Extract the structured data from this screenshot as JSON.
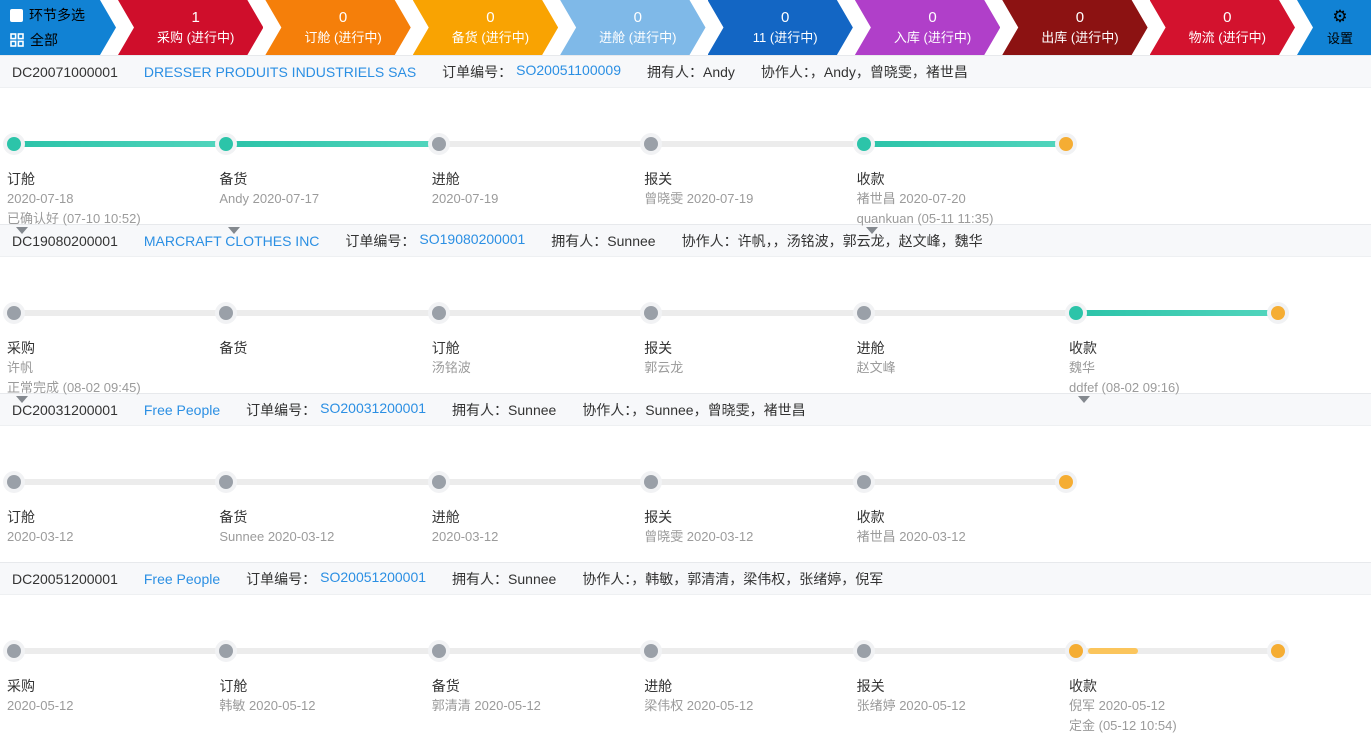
{
  "header": {
    "filter": {
      "multi_label": "环节多选",
      "all_label": "全部"
    },
    "stages": [
      {
        "count": "1",
        "label": "采购 (进行中)",
        "color": "#cf0e2b"
      },
      {
        "count": "0",
        "label": "订舱 (进行中)",
        "color": "#f57f0a"
      },
      {
        "count": "0",
        "label": "备货 (进行中)",
        "color": "#f9a302"
      },
      {
        "count": "0",
        "label": "进舱 (进行中)",
        "color": "#7fb9e8"
      },
      {
        "count": "0",
        "label": "11 (进行中)",
        "color": "#1366c4"
      },
      {
        "count": "0",
        "label": "入库 (进行中)",
        "color": "#b03fc9"
      },
      {
        "count": "0",
        "label": "出库 (进行中)",
        "color": "#8c1212"
      },
      {
        "count": "0",
        "label": "物流 (进行中)",
        "color": "#d3122e"
      }
    ],
    "filter_color": "#1182d4",
    "settings_label": "设置",
    "settings_color": "#1182d4",
    "gear_icon": "⚙"
  },
  "labels": {
    "order_no": "订单编号：",
    "owner": "拥有人：",
    "collaborators": "协作人："
  },
  "colors": {
    "done_teal": "#2cc4a9",
    "pending_gray": "#9aa0a8",
    "end_orange": "#f5ad33",
    "partial_orange": "#fbc55c",
    "link_blue": "#2b8fe3"
  },
  "orders": [
    {
      "code": "DC20071000001",
      "company": "DRESSER PRODUITS INDUSTRIELS SAS",
      "order_no": "SO20051100009",
      "owner": "Andy",
      "collaborators": "，Andy，曾晓雯，褚世昌",
      "end_dot": "orange",
      "stages": [
        {
          "name": "订舱",
          "line2": "2020-07-18",
          "line3": "已确认好 (07-10 10:52)",
          "dot": "teal",
          "seg": "teal",
          "expand": true
        },
        {
          "name": "备货",
          "line2": "Andy 2020-07-17",
          "line3": "",
          "dot": "teal",
          "seg": "teal",
          "expand": true
        },
        {
          "name": "进舱",
          "line2": "2020-07-19",
          "line3": "",
          "dot": "gray",
          "seg": "gray",
          "expand": false
        },
        {
          "name": "报关",
          "line2": "曾晓雯 2020-07-19",
          "line3": "",
          "dot": "gray",
          "seg": "gray",
          "expand": false
        },
        {
          "name": "收款",
          "line2": "褚世昌 2020-07-20",
          "line3": "quankuan (05-11 11:35)",
          "dot": "teal",
          "seg": "teal",
          "expand": true
        }
      ]
    },
    {
      "code": "DC19080200001",
      "company": "MARCRAFT CLOTHES INC",
      "order_no": "SO19080200001",
      "owner": "Sunnee",
      "collaborators": "许帆，，汤铭波，郭云龙，赵文峰，魏华",
      "end_dot": "orange",
      "stages": [
        {
          "name": "采购",
          "line2": "许帆",
          "line3": "正常完成 (08-02 09:45)",
          "dot": "gray",
          "seg": "gray",
          "expand": true
        },
        {
          "name": "备货",
          "line2": "",
          "line3": "",
          "dot": "gray",
          "seg": "gray",
          "expand": false
        },
        {
          "name": "订舱",
          "line2": "汤铭波",
          "line3": "",
          "dot": "gray",
          "seg": "gray",
          "expand": false
        },
        {
          "name": "报关",
          "line2": "郭云龙",
          "line3": "",
          "dot": "gray",
          "seg": "gray",
          "expand": false
        },
        {
          "name": "进舱",
          "line2": "赵文峰",
          "line3": "",
          "dot": "gray",
          "seg": "gray",
          "expand": false
        },
        {
          "name": "收款",
          "line2": "魏华",
          "line3": "ddfef (08-02 09:16)",
          "dot": "teal",
          "seg": "teal",
          "expand": true
        }
      ]
    },
    {
      "code": "DC20031200001",
      "company": "Free People",
      "order_no": "SO20031200001",
      "owner": "Sunnee",
      "collaborators": "，Sunnee，曾晓雯，褚世昌",
      "end_dot": "orange",
      "stages": [
        {
          "name": "订舱",
          "line2": "2020-03-12",
          "line3": "",
          "dot": "gray",
          "seg": "gray",
          "expand": false
        },
        {
          "name": "备货",
          "line2": "Sunnee 2020-03-12",
          "line3": "",
          "dot": "gray",
          "seg": "gray",
          "expand": false
        },
        {
          "name": "进舱",
          "line2": "2020-03-12",
          "line3": "",
          "dot": "gray",
          "seg": "gray",
          "expand": false
        },
        {
          "name": "报关",
          "line2": "曾晓雯 2020-03-12",
          "line3": "",
          "dot": "gray",
          "seg": "gray",
          "expand": false
        },
        {
          "name": "收款",
          "line2": "褚世昌 2020-03-12",
          "line3": "",
          "dot": "gray",
          "seg": "gray",
          "expand": false
        }
      ]
    },
    {
      "code": "DC20051200001",
      "company": "Free People",
      "order_no": "SO20051200001",
      "owner": "Sunnee",
      "collaborators": "，韩敏，郭清清，梁伟权，张绪婷，倪军",
      "end_dot": "orange",
      "stages": [
        {
          "name": "采购",
          "line2": "2020-05-12",
          "line3": "",
          "dot": "gray",
          "seg": "gray",
          "expand": false
        },
        {
          "name": "订舱",
          "line2": "韩敏 2020-05-12",
          "line3": "",
          "dot": "gray",
          "seg": "gray",
          "expand": false
        },
        {
          "name": "备货",
          "line2": "郭清清 2020-05-12",
          "line3": "",
          "dot": "gray",
          "seg": "gray",
          "expand": false
        },
        {
          "name": "进舱",
          "line2": "梁伟权 2020-05-12",
          "line3": "",
          "dot": "gray",
          "seg": "gray",
          "expand": false
        },
        {
          "name": "报关",
          "line2": "张绪婷 2020-05-12",
          "line3": "",
          "dot": "gray",
          "seg": "gray",
          "expand": false
        },
        {
          "name": "收款",
          "line2": "倪军 2020-05-12",
          "line3": "定金 (05-12 10:54)",
          "dot": "orange",
          "seg": "orange-partial",
          "expand": false
        }
      ]
    }
  ]
}
